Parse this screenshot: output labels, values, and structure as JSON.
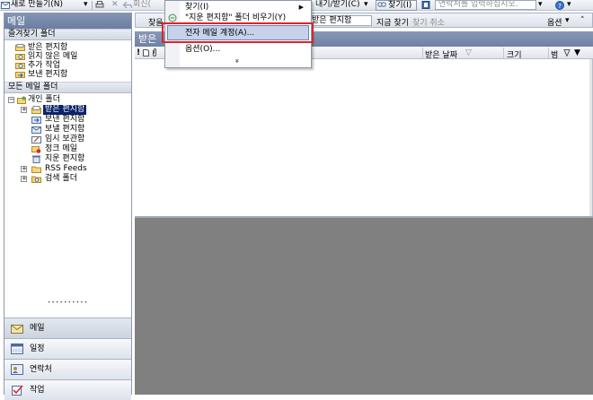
{
  "toolbar": {
    "new_label": "새로 만들기(N)",
    "reply_label": "회신(",
    "send_receive_label": "내기/받기(C)",
    "find_label": "찾기(I)",
    "contact_search_placeholder": "연락처를 입력하십시오.",
    "help_icon": "question-icon"
  },
  "nav": {
    "title": "메일",
    "favorites_header": "즐겨찾기 폴더",
    "favorites": [
      "받은 편지함",
      "읽지 않은 메일",
      "추가 작업",
      "보낸 편지함"
    ],
    "all_header": "모든 메일 폴더",
    "root_label": "개인 폴더",
    "folders": [
      {
        "label": "받은 편지함",
        "selected": true
      },
      {
        "label": "보낸 편지함"
      },
      {
        "label": "보낼 편지함"
      },
      {
        "label": "임시 보관함"
      },
      {
        "label": "정크 메일"
      },
      {
        "label": "지운 편지함"
      },
      {
        "label": "RSS Feeds"
      },
      {
        "label": "검색 폴더"
      }
    ],
    "buttons": {
      "mail": "메일",
      "calendar": "일정",
      "contacts": "연락처",
      "tasks": "작업"
    }
  },
  "main": {
    "search_bar": {
      "left_label": "찾을",
      "scope_value": "받은 편지함",
      "find_now": "지금 찾기",
      "clear_search": "찾기 취소",
      "options": "옵션"
    },
    "folder_title": "받은",
    "columns": {
      "received": "받은 날짜",
      "size": "크기",
      "category": "범"
    }
  },
  "menu": {
    "items": [
      "찾기(I)",
      "\"지운 편지함\" 폴더 비우기(Y)",
      "전자 메일 계정(A)...",
      "옵션(O)..."
    ],
    "highlighted_index": 2,
    "expand_glyph": "»"
  },
  "colors": {
    "accent_header": "#7283a6",
    "highlight_border": "#d9262a",
    "selection": "#0a246a",
    "reading_pane": "#808080"
  }
}
